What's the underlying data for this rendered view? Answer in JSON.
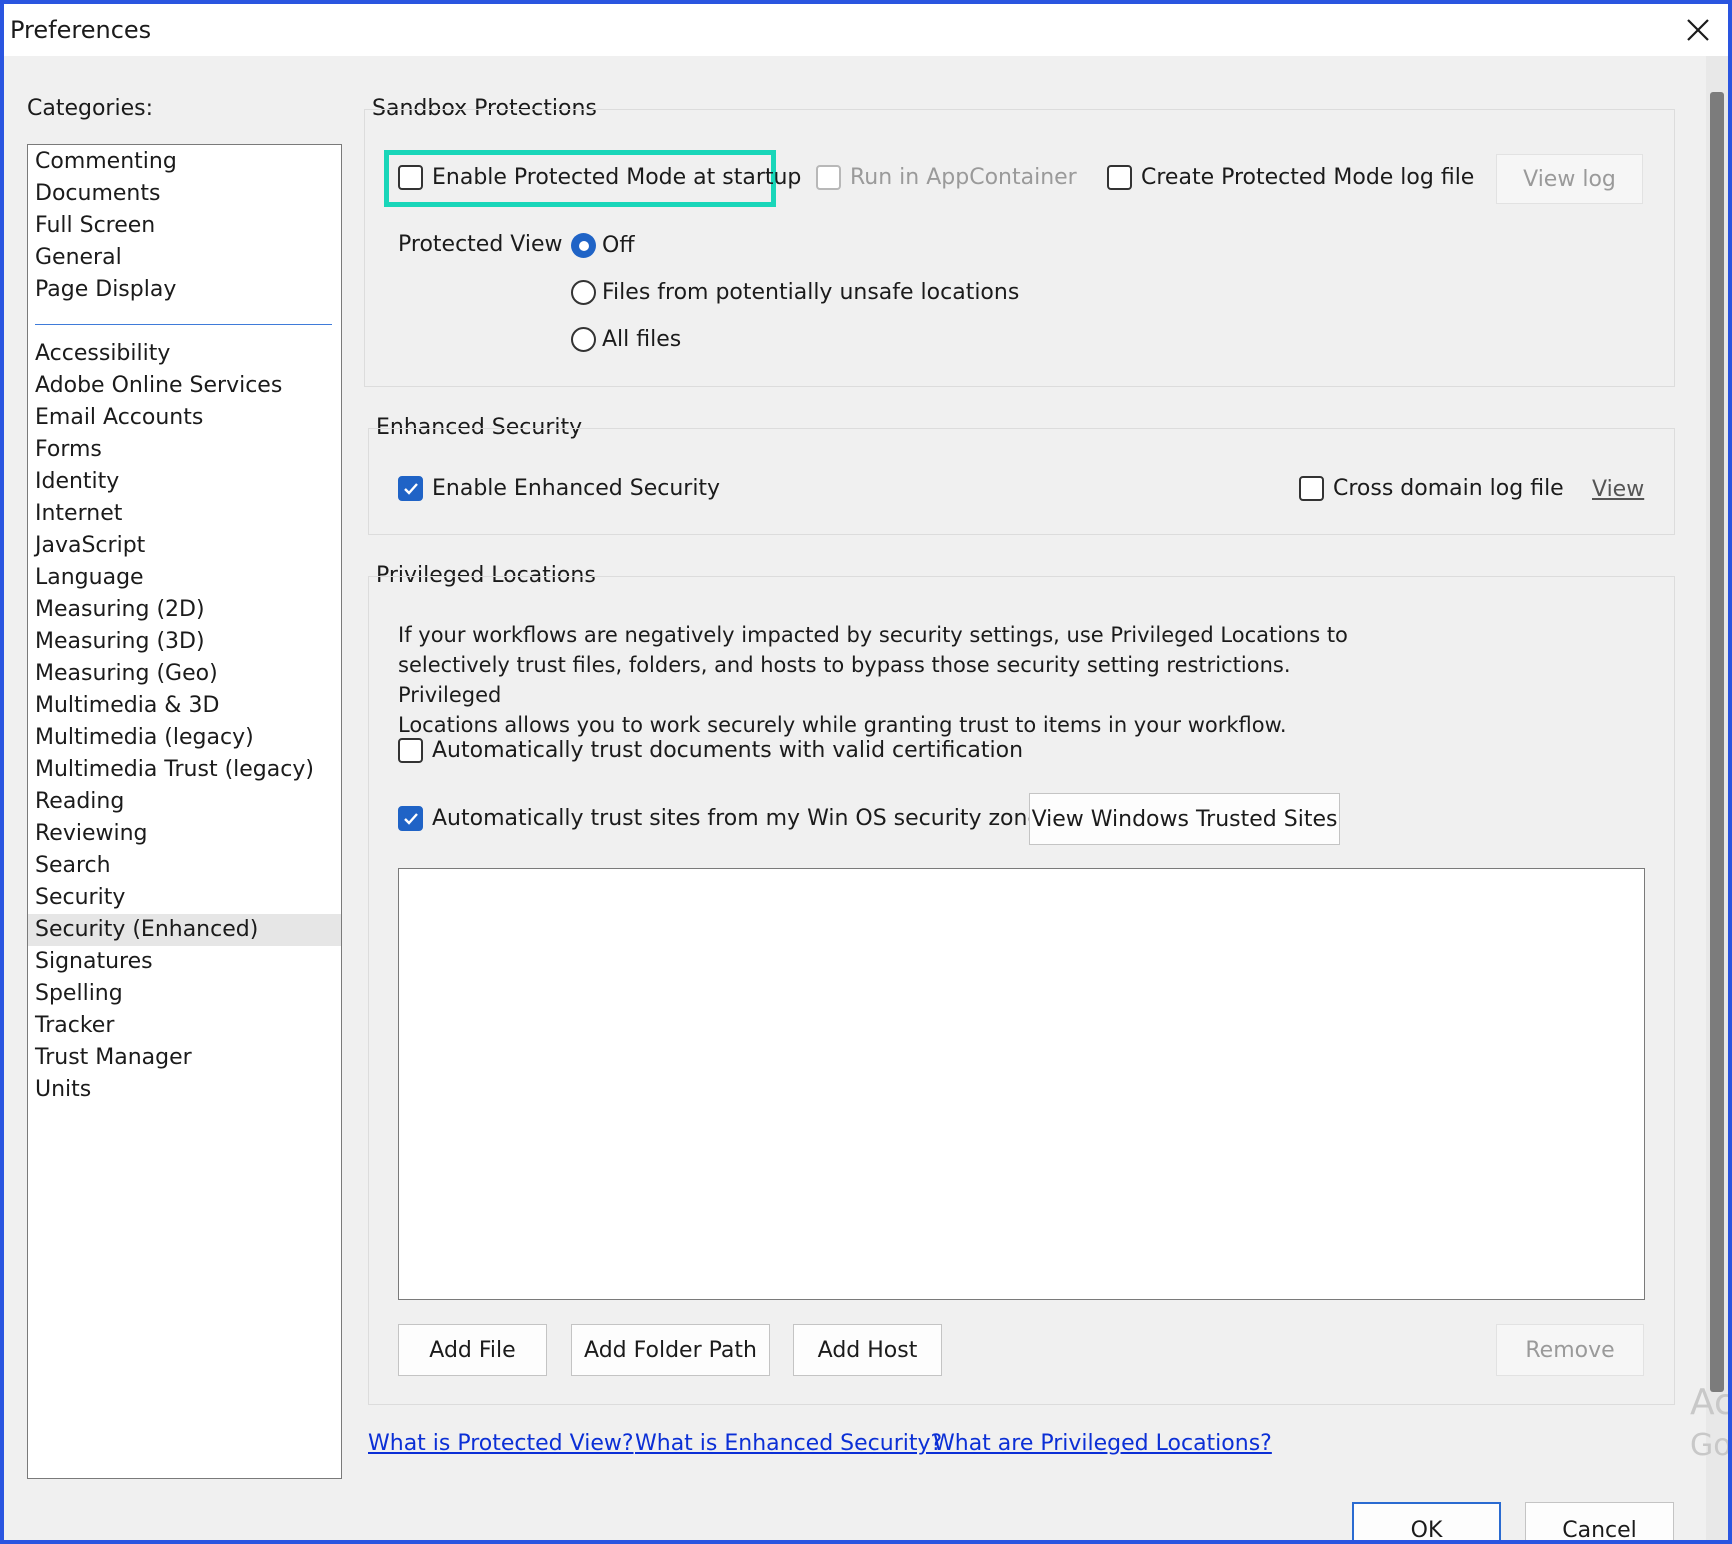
{
  "window": {
    "title": "Preferences"
  },
  "categories": {
    "label": "Categories:",
    "top_items": [
      "Commenting",
      "Documents",
      "Full Screen",
      "General",
      "Page Display"
    ],
    "items": [
      "Accessibility",
      "Adobe Online Services",
      "Email Accounts",
      "Forms",
      "Identity",
      "Internet",
      "JavaScript",
      "Language",
      "Measuring (2D)",
      "Measuring (3D)",
      "Measuring (Geo)",
      "Multimedia & 3D",
      "Multimedia (legacy)",
      "Multimedia Trust (legacy)",
      "Reading",
      "Reviewing",
      "Search",
      "Security",
      "Security (Enhanced)",
      "Signatures",
      "Spelling",
      "Tracker",
      "Trust Manager",
      "Units"
    ],
    "selected": "Security (Enhanced)"
  },
  "sandbox": {
    "title": "Sandbox Protections",
    "enable_protected_mode": {
      "label": "Enable Protected Mode at startup",
      "checked": false
    },
    "run_in_appcontainer": {
      "label": "Run in AppContainer",
      "checked": false,
      "disabled": true
    },
    "create_log": {
      "label": "Create Protected Mode log file",
      "checked": false
    },
    "view_log_button": "View log",
    "protected_view": {
      "label": "Protected View",
      "options": [
        "Off",
        "Files from potentially unsafe locations",
        "All files"
      ],
      "selected": "Off"
    }
  },
  "enhanced": {
    "title": "Enhanced Security",
    "enable": {
      "label": "Enable Enhanced Security",
      "checked": true
    },
    "cross_domain": {
      "label": "Cross domain log file",
      "checked": false
    },
    "view_link": "View"
  },
  "privileged": {
    "title": "Privileged Locations",
    "description_lines": [
      "If your workflows are negatively impacted by security settings, use Privileged Locations to",
      "selectively trust files, folders, and hosts to bypass those security setting restrictions. Privileged",
      "Locations allows you to work securely while granting trust to items in your workflow."
    ],
    "trust_docs": {
      "label": "Automatically trust documents with valid certification",
      "checked": false
    },
    "trust_sites": {
      "label": "Automatically trust sites from my Win OS security zones",
      "checked": true
    },
    "view_trusted_sites_button": "View Windows Trusted Sites",
    "buttons": {
      "add_file": "Add File",
      "add_folder": "Add Folder Path",
      "add_host": "Add Host",
      "remove": "Remove"
    }
  },
  "links": {
    "protected_view": "What is Protected View?",
    "enhanced_security": "What is Enhanced Security?",
    "privileged_locations": "What are Privileged Locations?"
  },
  "footer": {
    "ok": "OK",
    "cancel": "Cancel"
  },
  "watermark": {
    "line1": "Ac",
    "line2": "Go"
  },
  "colors": {
    "accent": "#1f63c6",
    "highlight": "#19d6b9",
    "window_border": "#2a55e0",
    "link": "#0b2fd6"
  }
}
